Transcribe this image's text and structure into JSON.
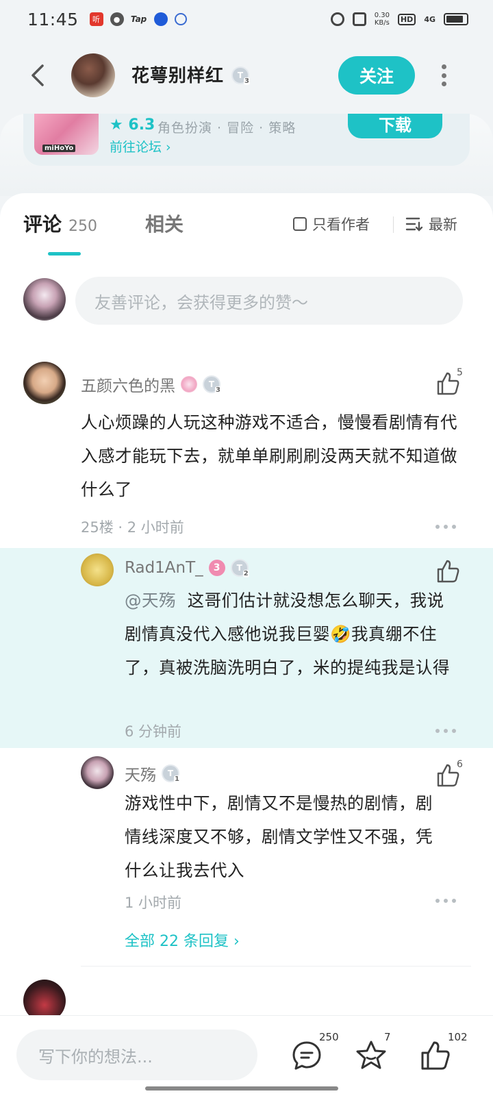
{
  "status_bar": {
    "time": "11:45",
    "app_icons": [
      "听",
      "chat",
      "Tap",
      "blue-app",
      "cloud-app"
    ],
    "speed_value": "0.30",
    "speed_unit": "KB/s",
    "hd": "HD",
    "network": "4G"
  },
  "header": {
    "author_name": "花萼别样红",
    "author_level": "T",
    "author_level_sub": "3",
    "follow_label": "关注"
  },
  "game_card": {
    "icon_brand": "miHoYo",
    "rating": "6.3",
    "tags": "角色扮演 · 冒险 · 策略",
    "forum_link": "前往论坛",
    "download_label": "下载"
  },
  "tabs": {
    "comments_label": "评论",
    "comments_count": "250",
    "related_label": "相关",
    "author_only_label": "只看作者",
    "sort_label": "最新"
  },
  "composer": {
    "placeholder": "友善评论，会获得更多的赞～"
  },
  "comments": [
    {
      "user": "五颜六色的黑",
      "level": "T",
      "level_sub": "3",
      "likes": "5",
      "text": "人心烦躁的人玩这种游戏不适合，慢慢看剧情有代入感才能玩下去，就单单刷刷刷没两天就不知道做什么了",
      "floor": "25楼",
      "time": "2 小时前",
      "replies": [
        {
          "user": "Rad1AnT_",
          "badge": "3",
          "level": "T",
          "level_sub": "2",
          "mention": "@天殇",
          "text": "这哥们估计就没想怎么聊天，我说剧情真没代入感他说我巨婴🤣我真绷不住了，真被洗脑洗明白了，米的提纯我是认得",
          "time": "6 分钟前"
        },
        {
          "user": "天殇",
          "level": "T",
          "level_sub": "1",
          "likes": "6",
          "text": "游戏性中下，剧情又不是慢热的剧情，剧情线深度又不够，剧情文学性又不强，凭什么让我去代入",
          "time": "1 小时前"
        }
      ],
      "view_all_replies": "全部 22 条回复"
    }
  ],
  "bottom_bar": {
    "placeholder": "写下你的想法...",
    "comment_count": "250",
    "favorite_count": "7",
    "like_count": "102"
  },
  "colors": {
    "accent": "#1ec2c6",
    "reply_highlight": "#e6f7f7"
  }
}
